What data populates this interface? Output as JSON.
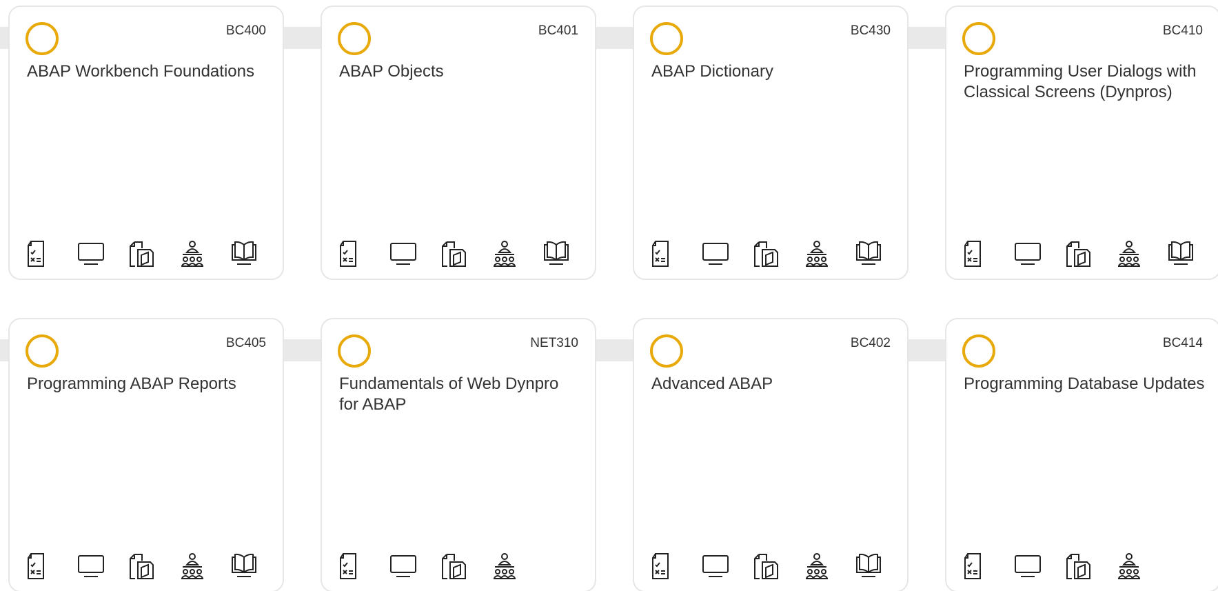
{
  "accent_color": "#e8a90a",
  "icon_color": "#222222",
  "courses": [
    {
      "code": "BC400",
      "title": "ABAP Workbench Foundations",
      "formats": [
        "exam-sheet-icon",
        "monitor-icon",
        "documents-icon",
        "classroom-icon",
        "book-icon"
      ]
    },
    {
      "code": "BC401",
      "title": "ABAP Objects",
      "formats": [
        "exam-sheet-icon",
        "monitor-icon",
        "documents-icon",
        "classroom-icon",
        "book-icon"
      ]
    },
    {
      "code": "BC430",
      "title": "ABAP Dictionary",
      "formats": [
        "exam-sheet-icon",
        "monitor-icon",
        "documents-icon",
        "classroom-icon",
        "book-icon"
      ]
    },
    {
      "code": "BC410",
      "title": "Programming User Dialogs with Classical Screens (Dynpros)",
      "formats": [
        "exam-sheet-icon",
        "monitor-icon",
        "documents-icon",
        "classroom-icon",
        "book-icon"
      ]
    },
    {
      "code": "BC405",
      "title": "Programming ABAP Reports",
      "formats": [
        "exam-sheet-icon",
        "monitor-icon",
        "documents-icon",
        "classroom-icon",
        "book-icon"
      ]
    },
    {
      "code": "NET310",
      "title": "Fundamentals of Web Dynpro for ABAP",
      "formats": [
        "exam-sheet-icon",
        "monitor-icon",
        "documents-icon",
        "classroom-icon"
      ]
    },
    {
      "code": "BC402",
      "title": "Advanced ABAP",
      "formats": [
        "exam-sheet-icon",
        "monitor-icon",
        "documents-icon",
        "classroom-icon",
        "book-icon"
      ]
    },
    {
      "code": "BC414",
      "title": "Programming Database Updates",
      "formats": [
        "exam-sheet-icon",
        "monitor-icon",
        "documents-icon",
        "classroom-icon"
      ]
    }
  ]
}
